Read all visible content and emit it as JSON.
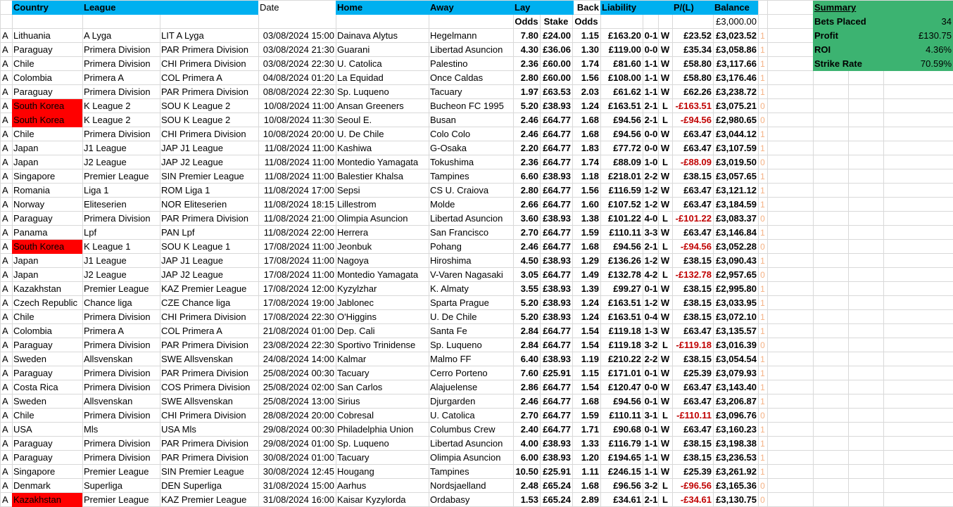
{
  "headers": {
    "country": "Country",
    "league": "League",
    "date": "Date",
    "home": "Home",
    "away": "Away",
    "lay": "Lay",
    "back": "Back",
    "liability": "Liability",
    "pl": "P/(L)",
    "balance": "Balance"
  },
  "subheaders": {
    "lay_odds": "Odds",
    "stake": "Stake",
    "back_odds": "Odds",
    "opening_balance": "£3,000.00"
  },
  "summary": {
    "title": "Summary",
    "rows": [
      {
        "label": "Bets Placed",
        "value": "34"
      },
      {
        "label": "Profit",
        "value": "£130.75"
      },
      {
        "label": "ROI",
        "value": "4.36%"
      },
      {
        "label": "Strike Rate",
        "value": "70.59%"
      }
    ]
  },
  "colors": {
    "header": "#00b0f0",
    "highlight": "#ff0000",
    "summary": "#3cb371",
    "negative": "#c00000"
  },
  "rows": [
    {
      "a": "A",
      "country": "Lithuania",
      "league": "A Lyga",
      "code": "LIT A Lyga",
      "date": "03/08/2024 15:00",
      "home": "Dainava Alytus",
      "away": "Hegelmann",
      "lay_odds": "7.80",
      "stake": "£24.00",
      "back_odds": "1.15",
      "liability": "£163.20",
      "score": "0-1",
      "result": "W",
      "pl": "£23.52",
      "balance": "£3,023.52",
      "flag": "1",
      "hl": false,
      "neg": false
    },
    {
      "a": "A",
      "country": "Paraguay",
      "league": "Primera Division",
      "code": "PAR Primera Division",
      "date": "03/08/2024 21:30",
      "home": "Guarani",
      "away": "Libertad Asuncion",
      "lay_odds": "4.30",
      "stake": "£36.06",
      "back_odds": "1.30",
      "liability": "£119.00",
      "score": "0-0",
      "result": "W",
      "pl": "£35.34",
      "balance": "£3,058.86",
      "flag": "1",
      "hl": false,
      "neg": false
    },
    {
      "a": "A",
      "country": "Chile",
      "league": "Primera Division",
      "code": "CHI Primera Division",
      "date": "03/08/2024 22:30",
      "home": "U. Catolica",
      "away": "Palestino",
      "lay_odds": "2.36",
      "stake": "£60.00",
      "back_odds": "1.74",
      "liability": "£81.60",
      "score": "1-1",
      "result": "W",
      "pl": "£58.80",
      "balance": "£3,117.66",
      "flag": "1",
      "hl": false,
      "neg": false
    },
    {
      "a": "A",
      "country": "Colombia",
      "league": "Primera A",
      "code": "COL Primera A",
      "date": "04/08/2024 01:20",
      "home": "La Equidad",
      "away": "Once Caldas",
      "lay_odds": "2.80",
      "stake": "£60.00",
      "back_odds": "1.56",
      "liability": "£108.00",
      "score": "1-1",
      "result": "W",
      "pl": "£58.80",
      "balance": "£3,176.46",
      "flag": "1",
      "hl": false,
      "neg": false
    },
    {
      "a": "A",
      "country": "Paraguay",
      "league": "Primera Division",
      "code": "PAR Primera Division",
      "date": "08/08/2024 22:30",
      "home": "Sp. Luqueno",
      "away": "Tacuary",
      "lay_odds": "1.97",
      "stake": "£63.53",
      "back_odds": "2.03",
      "liability": "£61.62",
      "score": "1-1",
      "result": "W",
      "pl": "£62.26",
      "balance": "£3,238.72",
      "flag": "1",
      "hl": false,
      "neg": false
    },
    {
      "a": "A",
      "country": "South Korea",
      "league": "K League 2",
      "code": "SOU K League 2",
      "date": "10/08/2024 11:00",
      "home": "Ansan Greeners",
      "away": "Bucheon FC 1995",
      "lay_odds": "5.20",
      "stake": "£38.93",
      "back_odds": "1.24",
      "liability": "£163.51",
      "score": "2-1",
      "result": "L",
      "pl": "-£163.51",
      "balance": "£3,075.21",
      "flag": "0",
      "hl": true,
      "neg": true
    },
    {
      "a": "A",
      "country": "South Korea",
      "league": "K League 2",
      "code": "SOU K League 2",
      "date": "10/08/2024 11:30",
      "home": "Seoul E.",
      "away": "Busan",
      "lay_odds": "2.46",
      "stake": "£64.77",
      "back_odds": "1.68",
      "liability": "£94.56",
      "score": "2-1",
      "result": "L",
      "pl": "-£94.56",
      "balance": "£2,980.65",
      "flag": "0",
      "hl": true,
      "neg": true
    },
    {
      "a": "A",
      "country": "Chile",
      "league": "Primera Division",
      "code": "CHI Primera Division",
      "date": "10/08/2024 20:00",
      "home": "U. De Chile",
      "away": "Colo Colo",
      "lay_odds": "2.46",
      "stake": "£64.77",
      "back_odds": "1.68",
      "liability": "£94.56",
      "score": "0-0",
      "result": "W",
      "pl": "£63.47",
      "balance": "£3,044.12",
      "flag": "1",
      "hl": false,
      "neg": false
    },
    {
      "a": "A",
      "country": "Japan",
      "league": "J1 League",
      "code": "JAP J1 League",
      "date": "11/08/2024 11:00",
      "home": "Kashiwa",
      "away": "G-Osaka",
      "lay_odds": "2.20",
      "stake": "£64.77",
      "back_odds": "1.83",
      "liability": "£77.72",
      "score": "0-0",
      "result": "W",
      "pl": "£63.47",
      "balance": "£3,107.59",
      "flag": "1",
      "hl": false,
      "neg": false
    },
    {
      "a": "A",
      "country": "Japan",
      "league": "J2 League",
      "code": "JAP J2 League",
      "date": "11/08/2024 11:00",
      "home": "Montedio Yamagata",
      "away": "Tokushima",
      "lay_odds": "2.36",
      "stake": "£64.77",
      "back_odds": "1.74",
      "liability": "£88.09",
      "score": "1-0",
      "result": "L",
      "pl": "-£88.09",
      "balance": "£3,019.50",
      "flag": "0",
      "hl": false,
      "neg": true
    },
    {
      "a": "A",
      "country": "Singapore",
      "league": "Premier League",
      "code": "SIN Premier League",
      "date": "11/08/2024 11:00",
      "home": "Balestier Khalsa",
      "away": "Tampines",
      "lay_odds": "6.60",
      "stake": "£38.93",
      "back_odds": "1.18",
      "liability": "£218.01",
      "score": "2-2",
      "result": "W",
      "pl": "£38.15",
      "balance": "£3,057.65",
      "flag": "1",
      "hl": false,
      "neg": false
    },
    {
      "a": "A",
      "country": "Romania",
      "league": "Liga 1",
      "code": "ROM Liga 1",
      "date": "11/08/2024 17:00",
      "home": "Sepsi",
      "away": "CS U. Craiova",
      "lay_odds": "2.80",
      "stake": "£64.77",
      "back_odds": "1.56",
      "liability": "£116.59",
      "score": "1-2",
      "result": "W",
      "pl": "£63.47",
      "balance": "£3,121.12",
      "flag": "1",
      "hl": false,
      "neg": false
    },
    {
      "a": "A",
      "country": "Norway",
      "league": "Eliteserien",
      "code": "NOR Eliteserien",
      "date": "11/08/2024 18:15",
      "home": "Lillestrom",
      "away": "Molde",
      "lay_odds": "2.66",
      "stake": "£64.77",
      "back_odds": "1.60",
      "liability": "£107.52",
      "score": "1-2",
      "result": "W",
      "pl": "£63.47",
      "balance": "£3,184.59",
      "flag": "1",
      "hl": false,
      "neg": false
    },
    {
      "a": "A",
      "country": "Paraguay",
      "league": "Primera Division",
      "code": "PAR Primera Division",
      "date": "11/08/2024 21:00",
      "home": "Olimpia Asuncion",
      "away": "Libertad Asuncion",
      "lay_odds": "3.60",
      "stake": "£38.93",
      "back_odds": "1.38",
      "liability": "£101.22",
      "score": "4-0",
      "result": "L",
      "pl": "-£101.22",
      "balance": "£3,083.37",
      "flag": "0",
      "hl": false,
      "neg": true
    },
    {
      "a": "A",
      "country": "Panama",
      "league": "Lpf",
      "code": "PAN Lpf",
      "date": "11/08/2024 22:00",
      "home": "Herrera",
      "away": "San Francisco",
      "lay_odds": "2.70",
      "stake": "£64.77",
      "back_odds": "1.59",
      "liability": "£110.11",
      "score": "3-3",
      "result": "W",
      "pl": "£63.47",
      "balance": "£3,146.84",
      "flag": "1",
      "hl": false,
      "neg": false
    },
    {
      "a": "A",
      "country": "South Korea",
      "league": "K League 1",
      "code": "SOU K League 1",
      "date": "17/08/2024 11:00",
      "home": "Jeonbuk",
      "away": "Pohang",
      "lay_odds": "2.46",
      "stake": "£64.77",
      "back_odds": "1.68",
      "liability": "£94.56",
      "score": "2-1",
      "result": "L",
      "pl": "-£94.56",
      "balance": "£3,052.28",
      "flag": "0",
      "hl": true,
      "neg": true
    },
    {
      "a": "A",
      "country": "Japan",
      "league": "J1 League",
      "code": "JAP J1 League",
      "date": "17/08/2024 11:00",
      "home": "Nagoya",
      "away": "Hiroshima",
      "lay_odds": "4.50",
      "stake": "£38.93",
      "back_odds": "1.29",
      "liability": "£136.26",
      "score": "1-2",
      "result": "W",
      "pl": "£38.15",
      "balance": "£3,090.43",
      "flag": "1",
      "hl": false,
      "neg": false
    },
    {
      "a": "A",
      "country": "Japan",
      "league": "J2 League",
      "code": "JAP J2 League",
      "date": "17/08/2024 11:00",
      "home": "Montedio Yamagata",
      "away": "V-Varen Nagasaki",
      "lay_odds": "3.05",
      "stake": "£64.77",
      "back_odds": "1.49",
      "liability": "£132.78",
      "score": "4-2",
      "result": "L",
      "pl": "-£132.78",
      "balance": "£2,957.65",
      "flag": "0",
      "hl": false,
      "neg": true
    },
    {
      "a": "A",
      "country": "Kazakhstan",
      "league": "Premier League",
      "code": "KAZ Premier League",
      "date": "17/08/2024 12:00",
      "home": "Kyzylzhar",
      "away": "K. Almaty",
      "lay_odds": "3.55",
      "stake": "£38.93",
      "back_odds": "1.39",
      "liability": "£99.27",
      "score": "0-1",
      "result": "W",
      "pl": "£38.15",
      "balance": "£2,995.80",
      "flag": "1",
      "hl": false,
      "neg": false
    },
    {
      "a": "A",
      "country": "Czech Republic",
      "league": "Chance liga",
      "code": "CZE Chance liga",
      "date": "17/08/2024 19:00",
      "home": "Jablonec",
      "away": "Sparta Prague",
      "lay_odds": "5.20",
      "stake": "£38.93",
      "back_odds": "1.24",
      "liability": "£163.51",
      "score": "1-2",
      "result": "W",
      "pl": "£38.15",
      "balance": "£3,033.95",
      "flag": "1",
      "hl": false,
      "neg": false
    },
    {
      "a": "A",
      "country": "Chile",
      "league": "Primera Division",
      "code": "CHI Primera Division",
      "date": "17/08/2024 22:30",
      "home": "O'Higgins",
      "away": "U. De Chile",
      "lay_odds": "5.20",
      "stake": "£38.93",
      "back_odds": "1.24",
      "liability": "£163.51",
      "score": "0-4",
      "result": "W",
      "pl": "£38.15",
      "balance": "£3,072.10",
      "flag": "1",
      "hl": false,
      "neg": false
    },
    {
      "a": "A",
      "country": "Colombia",
      "league": "Primera A",
      "code": "COL Primera A",
      "date": "21/08/2024 01:00",
      "home": "Dep. Cali",
      "away": "Santa Fe",
      "lay_odds": "2.84",
      "stake": "£64.77",
      "back_odds": "1.54",
      "liability": "£119.18",
      "score": "1-3",
      "result": "W",
      "pl": "£63.47",
      "balance": "£3,135.57",
      "flag": "1",
      "hl": false,
      "neg": false
    },
    {
      "a": "A",
      "country": "Paraguay",
      "league": "Primera Division",
      "code": "PAR Primera Division",
      "date": "23/08/2024 22:30",
      "home": "Sportivo Trinidense",
      "away": "Sp. Luqueno",
      "lay_odds": "2.84",
      "stake": "£64.77",
      "back_odds": "1.54",
      "liability": "£119.18",
      "score": "3-2",
      "result": "L",
      "pl": "-£119.18",
      "balance": "£3,016.39",
      "flag": "0",
      "hl": false,
      "neg": true
    },
    {
      "a": "A",
      "country": "Sweden",
      "league": "Allsvenskan",
      "code": "SWE Allsvenskan",
      "date": "24/08/2024 14:00",
      "home": "Kalmar",
      "away": "Malmo FF",
      "lay_odds": "6.40",
      "stake": "£38.93",
      "back_odds": "1.19",
      "liability": "£210.22",
      "score": "2-2",
      "result": "W",
      "pl": "£38.15",
      "balance": "£3,054.54",
      "flag": "1",
      "hl": false,
      "neg": false
    },
    {
      "a": "A",
      "country": "Paraguay",
      "league": "Primera Division",
      "code": "PAR Primera Division",
      "date": "25/08/2024 00:30",
      "home": "Tacuary",
      "away": "Cerro Porteno",
      "lay_odds": "7.60",
      "stake": "£25.91",
      "back_odds": "1.15",
      "liability": "£171.01",
      "score": "0-1",
      "result": "W",
      "pl": "£25.39",
      "balance": "£3,079.93",
      "flag": "1",
      "hl": false,
      "neg": false
    },
    {
      "a": "A",
      "country": "Costa Rica",
      "league": "Primera Division",
      "code": "COS Primera Division",
      "date": "25/08/2024 02:00",
      "home": "San Carlos",
      "away": "Alajuelense",
      "lay_odds": "2.86",
      "stake": "£64.77",
      "back_odds": "1.54",
      "liability": "£120.47",
      "score": "0-0",
      "result": "W",
      "pl": "£63.47",
      "balance": "£3,143.40",
      "flag": "1",
      "hl": false,
      "neg": false
    },
    {
      "a": "A",
      "country": "Sweden",
      "league": "Allsvenskan",
      "code": "SWE Allsvenskan",
      "date": "25/08/2024 13:00",
      "home": "Sirius",
      "away": "Djurgarden",
      "lay_odds": "2.46",
      "stake": "£64.77",
      "back_odds": "1.68",
      "liability": "£94.56",
      "score": "0-1",
      "result": "W",
      "pl": "£63.47",
      "balance": "£3,206.87",
      "flag": "1",
      "hl": false,
      "neg": false
    },
    {
      "a": "A",
      "country": "Chile",
      "league": "Primera Division",
      "code": "CHI Primera Division",
      "date": "28/08/2024 20:00",
      "home": "Cobresal",
      "away": "U. Catolica",
      "lay_odds": "2.70",
      "stake": "£64.77",
      "back_odds": "1.59",
      "liability": "£110.11",
      "score": "3-1",
      "result": "L",
      "pl": "-£110.11",
      "balance": "£3,096.76",
      "flag": "0",
      "hl": false,
      "neg": true
    },
    {
      "a": "A",
      "country": "USA",
      "league": "Mls",
      "code": "USA Mls",
      "date": "29/08/2024 00:30",
      "home": "Philadelphia Union",
      "away": "Columbus Crew",
      "lay_odds": "2.40",
      "stake": "£64.77",
      "back_odds": "1.71",
      "liability": "£90.68",
      "score": "0-1",
      "result": "W",
      "pl": "£63.47",
      "balance": "£3,160.23",
      "flag": "1",
      "hl": false,
      "neg": false
    },
    {
      "a": "A",
      "country": "Paraguay",
      "league": "Primera Division",
      "code": "PAR Primera Division",
      "date": "29/08/2024 01:00",
      "home": "Sp. Luqueno",
      "away": "Libertad Asuncion",
      "lay_odds": "4.00",
      "stake": "£38.93",
      "back_odds": "1.33",
      "liability": "£116.79",
      "score": "1-1",
      "result": "W",
      "pl": "£38.15",
      "balance": "£3,198.38",
      "flag": "1",
      "hl": false,
      "neg": false
    },
    {
      "a": "A",
      "country": "Paraguay",
      "league": "Primera Division",
      "code": "PAR Primera Division",
      "date": "30/08/2024 01:00",
      "home": "Tacuary",
      "away": "Olimpia Asuncion",
      "lay_odds": "6.00",
      "stake": "£38.93",
      "back_odds": "1.20",
      "liability": "£194.65",
      "score": "1-1",
      "result": "W",
      "pl": "£38.15",
      "balance": "£3,236.53",
      "flag": "1",
      "hl": false,
      "neg": false
    },
    {
      "a": "A",
      "country": "Singapore",
      "league": "Premier League",
      "code": "SIN Premier League",
      "date": "30/08/2024 12:45",
      "home": "Hougang",
      "away": "Tampines",
      "lay_odds": "10.50",
      "stake": "£25.91",
      "back_odds": "1.11",
      "liability": "£246.15",
      "score": "1-1",
      "result": "W",
      "pl": "£25.39",
      "balance": "£3,261.92",
      "flag": "1",
      "hl": false,
      "neg": false
    },
    {
      "a": "A",
      "country": "Denmark",
      "league": "Superliga",
      "code": "DEN Superliga",
      "date": "31/08/2024 15:00",
      "home": "Aarhus",
      "away": "Nordsjaelland",
      "lay_odds": "2.48",
      "stake": "£65.24",
      "back_odds": "1.68",
      "liability": "£96.56",
      "score": "3-2",
      "result": "L",
      "pl": "-£96.56",
      "balance": "£3,165.36",
      "flag": "0",
      "hl": false,
      "neg": true
    },
    {
      "a": "A",
      "country": "Kazakhstan",
      "league": "Premier League",
      "code": "KAZ Premier League",
      "date": "31/08/2024 16:00",
      "home": "Kaisar Kyzylorda",
      "away": "Ordabasy",
      "lay_odds": "1.53",
      "stake": "£65.24",
      "back_odds": "2.89",
      "liability": "£34.61",
      "score": "2-1",
      "result": "L",
      "pl": "-£34.61",
      "balance": "£3,130.75",
      "flag": "0",
      "hl": true,
      "neg": true
    }
  ]
}
